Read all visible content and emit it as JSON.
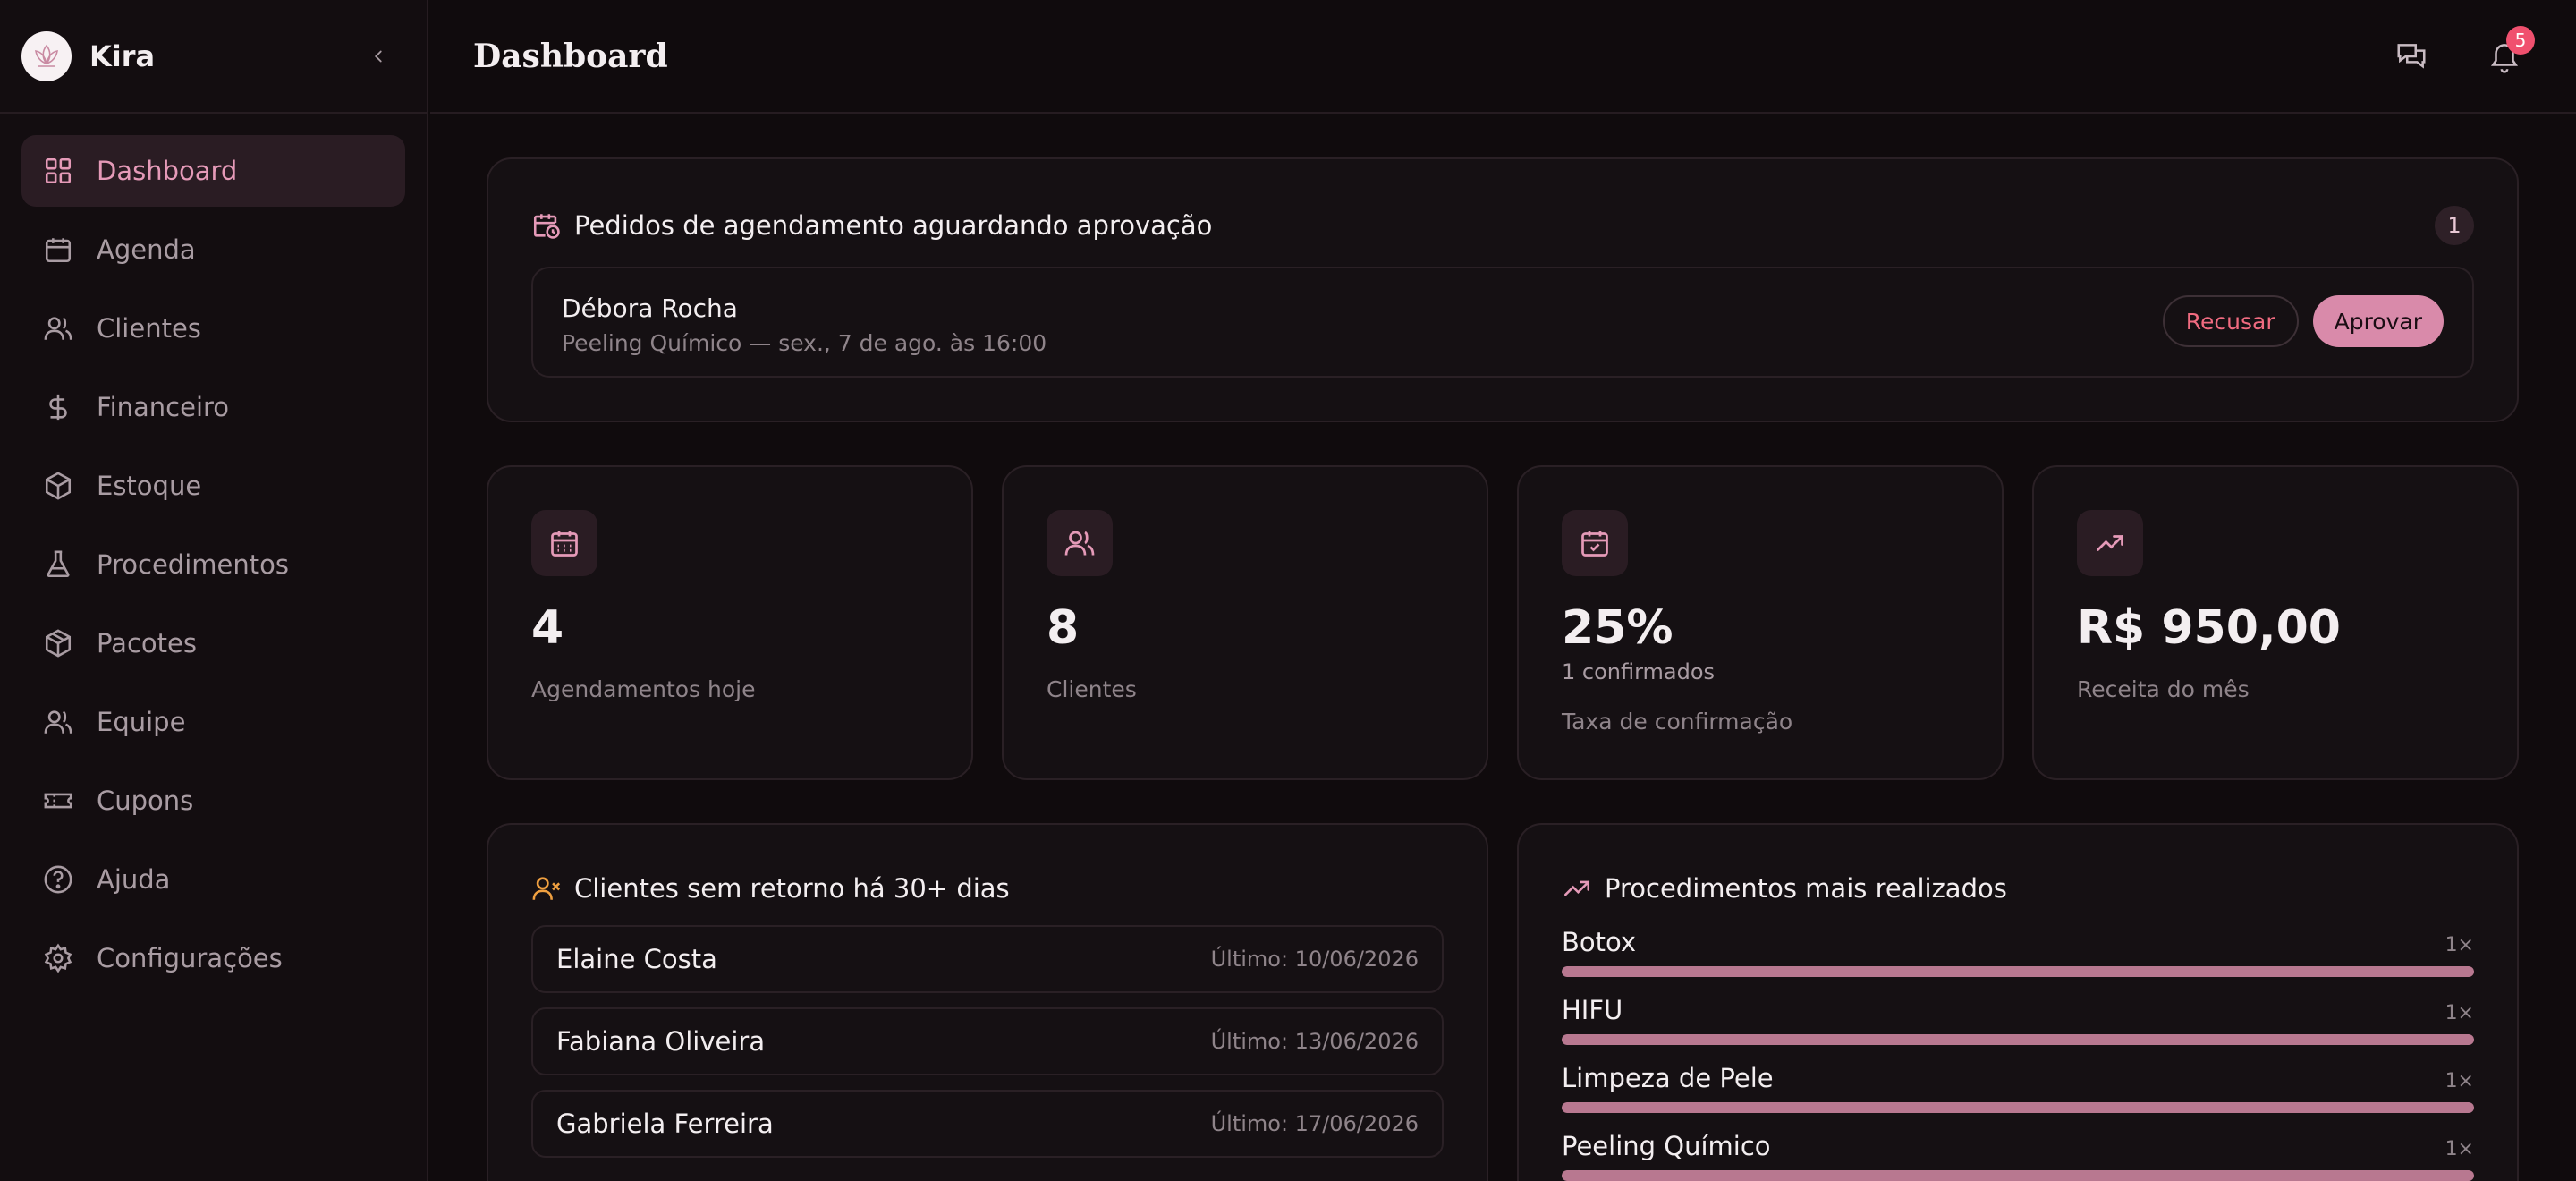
{
  "app": {
    "brand": "Kira"
  },
  "sidebar": {
    "items": [
      {
        "label": "Dashboard",
        "icon": "dashboard-icon",
        "active": true
      },
      {
        "label": "Agenda",
        "icon": "calendar-icon"
      },
      {
        "label": "Clientes",
        "icon": "users-icon"
      },
      {
        "label": "Financeiro",
        "icon": "dollar-icon"
      },
      {
        "label": "Estoque",
        "icon": "box-icon"
      },
      {
        "label": "Procedimentos",
        "icon": "flask-icon"
      },
      {
        "label": "Pacotes",
        "icon": "package-icon"
      },
      {
        "label": "Equipe",
        "icon": "team-icon"
      },
      {
        "label": "Cupons",
        "icon": "ticket-icon"
      },
      {
        "label": "Ajuda",
        "icon": "help-icon"
      },
      {
        "label": "Configurações",
        "icon": "gear-icon"
      }
    ]
  },
  "header": {
    "title": "Dashboard",
    "notification_count": "5"
  },
  "requests": {
    "title": "Pedidos de agendamento aguardando aprovação",
    "count": "1",
    "items": [
      {
        "name": "Débora Rocha",
        "detail": "Peeling Químico — sex., 7 de ago. às 16:00",
        "refuse_label": "Recusar",
        "approve_label": "Aprovar"
      }
    ]
  },
  "stats": [
    {
      "icon": "calendar-icon",
      "value": "4",
      "label": "Agendamentos hoje"
    },
    {
      "icon": "users-icon",
      "value": "8",
      "label": "Clientes"
    },
    {
      "icon": "calendar-check-icon",
      "value": "25%",
      "sub": "1 confirmados",
      "label": "Taxa de confirmação"
    },
    {
      "icon": "trending-up-icon",
      "value": "R$ 950,00",
      "label": "Receita do mês"
    }
  ],
  "inactive_clients": {
    "title": "Clientes sem retorno há 30+ dias",
    "items": [
      {
        "name": "Elaine Costa",
        "last": "Último: 10/06/2026"
      },
      {
        "name": "Fabiana Oliveira",
        "last": "Último: 13/06/2026"
      },
      {
        "name": "Gabriela Ferreira",
        "last": "Último: 17/06/2026"
      }
    ]
  },
  "top_procedures": {
    "title": "Procedimentos mais realizados",
    "items": [
      {
        "name": "Botox",
        "count": "1×",
        "share": 1.0
      },
      {
        "name": "HIFU",
        "count": "1×",
        "share": 1.0
      },
      {
        "name": "Limpeza de Pele",
        "count": "1×",
        "share": 1.0
      },
      {
        "name": "Peeling Químico",
        "count": "1×",
        "share": 1.0
      }
    ]
  },
  "colors": {
    "accent": "#d98aaa",
    "accent_text": "#e59ab8",
    "danger": "#f06b80",
    "warning": "#f0a040"
  }
}
